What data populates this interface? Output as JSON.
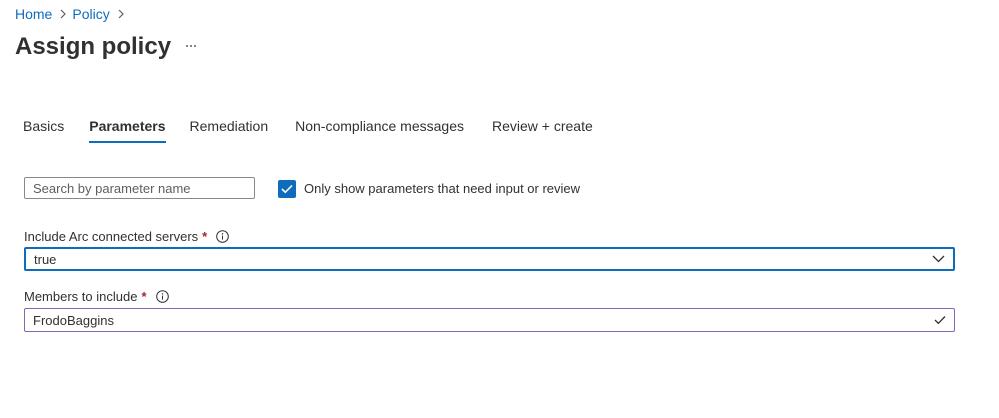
{
  "breadcrumb": {
    "items": [
      "Home",
      "Policy"
    ],
    "separator_icon": "chevron-right-icon"
  },
  "header": {
    "title": "Assign policy",
    "more_label": "···"
  },
  "tabs": [
    {
      "label": "Basics",
      "active": false
    },
    {
      "label": "Parameters",
      "active": true
    },
    {
      "label": "Remediation",
      "active": false
    },
    {
      "label": "Non-compliance messages",
      "active": false
    },
    {
      "label": "Review + create",
      "active": false
    }
  ],
  "filter": {
    "search_placeholder": "Search by parameter name",
    "search_value": "",
    "checkbox_label": "Only show parameters that need input or review",
    "checkbox_checked": true
  },
  "parameters": [
    {
      "label": "Include Arc connected servers",
      "required_mark": "*",
      "info_icon": "info-icon",
      "control": "dropdown",
      "value": "true",
      "control_icon": "chevron-down-icon"
    },
    {
      "label": "Members to include",
      "required_mark": "*",
      "info_icon": "info-icon",
      "control": "text",
      "value": "FrodoBaggins",
      "control_icon": "checkmark-icon"
    }
  ],
  "colors": {
    "accent": "#0f6cbd",
    "required": "#a4262c",
    "valid_border": "#8764b8",
    "text": "#323130"
  }
}
